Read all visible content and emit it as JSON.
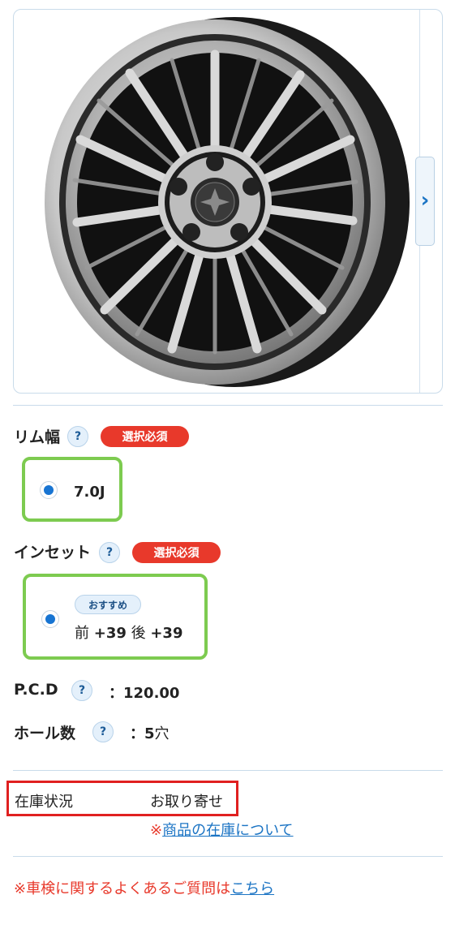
{
  "gallery": {
    "next_arrow": "›"
  },
  "rim_width": {
    "label": "リム幅",
    "help": "?",
    "required": "選択必須",
    "options": [
      {
        "label": "7.0J",
        "selected": true
      }
    ]
  },
  "inset": {
    "label": "インセット",
    "help": "?",
    "required": "選択必須",
    "options": [
      {
        "badge": "おすすめ",
        "front_label": "前",
        "front_value": "+39",
        "rear_label": "後",
        "rear_value": "+39",
        "selected": true
      }
    ]
  },
  "pcd": {
    "label": "P.C.D",
    "help": "?",
    "value": "：120.00"
  },
  "holes": {
    "label": "ホール数",
    "help": "?",
    "value": "：5",
    "unit": "穴"
  },
  "stock": {
    "label": "在庫状況",
    "value": "お取り寄せ",
    "note_mark": "※",
    "note_link": "商品の在庫について"
  },
  "faq": {
    "text": "※車検に関するよくあるご質問は",
    "link": "こちら"
  },
  "colors": {
    "accent": "#1774d2",
    "required": "#e8392b",
    "selected_border": "#7dcb50",
    "highlight": "#e02020"
  }
}
